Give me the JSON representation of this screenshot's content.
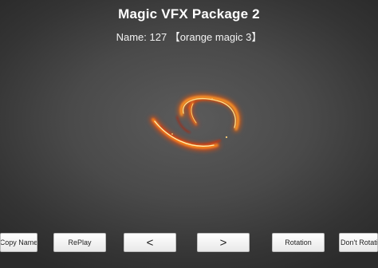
{
  "header": {
    "title": "Magic VFX Package 2",
    "subtitle": "Name: 127 【orange magic 3】"
  },
  "effect": {
    "icon": "orange-magic-swirl",
    "colors": [
      "#fff3c4",
      "#ffb020",
      "#ff5a10",
      "#c81e0a"
    ]
  },
  "buttons": {
    "copy_name": "Copy Name",
    "replay": "RePlay",
    "prev": "<",
    "next": ">",
    "rotation": "Rotation",
    "dont_rotation": "Don't Rotation"
  }
}
